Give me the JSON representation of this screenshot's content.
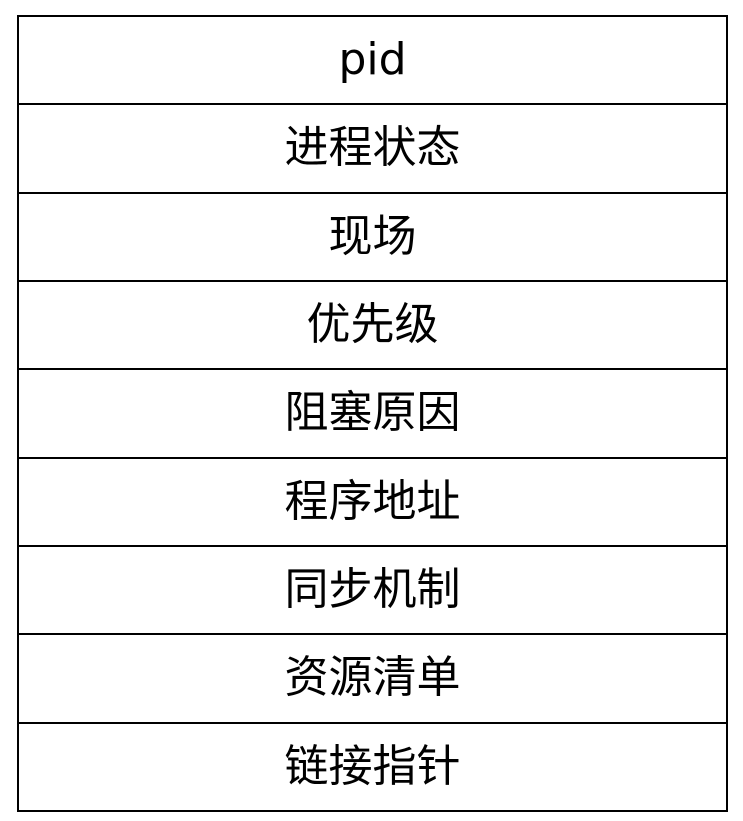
{
  "pcb_fields": [
    "pid",
    "进程状态",
    "现场",
    "优先级",
    "阻塞原因",
    "程序地址",
    "同步机制",
    "资源清单",
    "链接指针"
  ]
}
